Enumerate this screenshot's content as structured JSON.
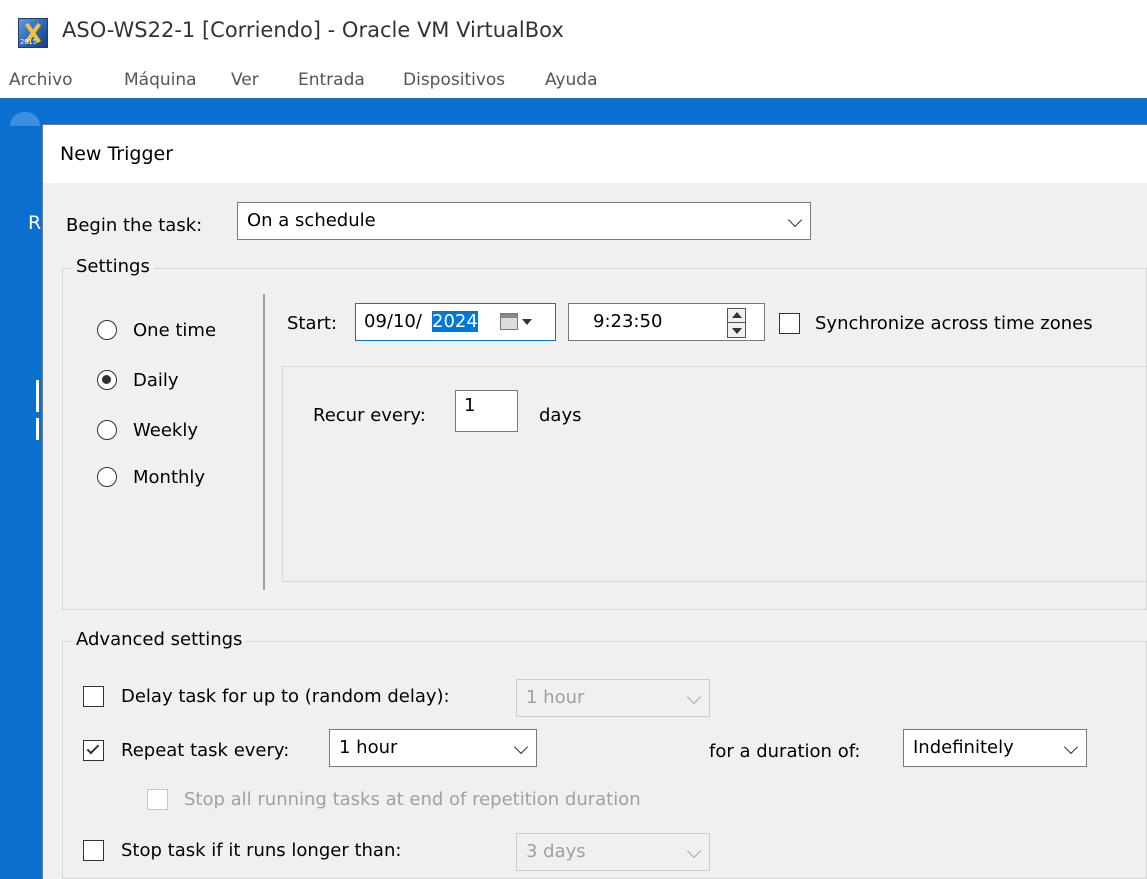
{
  "window": {
    "title": "ASO-WS22-1 [Corriendo] - Oracle VM VirtualBox",
    "icon": "virtualbox-icon",
    "icon_version_text": "2015"
  },
  "menubar": {
    "items": [
      "Archivo",
      "Máquina",
      "Ver",
      "Entrada",
      "Dispositivos",
      "Ayuda"
    ]
  },
  "guest": {
    "desktop_letter": "R"
  },
  "dialog": {
    "title": "New Trigger",
    "begin_task": {
      "label": "Begin the task:",
      "value": "On a schedule"
    },
    "settings": {
      "legend": "Settings",
      "radios": [
        {
          "label": "One time",
          "selected": false
        },
        {
          "label": "Daily",
          "selected": true
        },
        {
          "label": "Weekly",
          "selected": false
        },
        {
          "label": "Monthly",
          "selected": false
        }
      ],
      "start_label": "Start:",
      "start_date_prefix": "09/10/",
      "start_date_selected": "2024",
      "start_time": "9:23:50",
      "sync_label": "Synchronize across time zones",
      "sync_checked": false,
      "recur_label": "Recur every:",
      "recur_value": "1",
      "recur_unit": "days"
    },
    "advanced": {
      "legend": "Advanced settings",
      "delay": {
        "label": "Delay task for up to (random delay):",
        "checked": false,
        "value": "1 hour",
        "enabled": false
      },
      "repeat": {
        "label": "Repeat task every:",
        "checked": true,
        "value": "1 hour",
        "duration_label": "for a duration of:",
        "duration_value": "Indefinitely"
      },
      "stop_all": {
        "label": "Stop all running tasks at end of repetition duration",
        "checked": false,
        "enabled": false
      },
      "stop_longer": {
        "label": "Stop task if it runs longer than:",
        "checked": false,
        "value": "3 days",
        "enabled": false
      }
    }
  }
}
